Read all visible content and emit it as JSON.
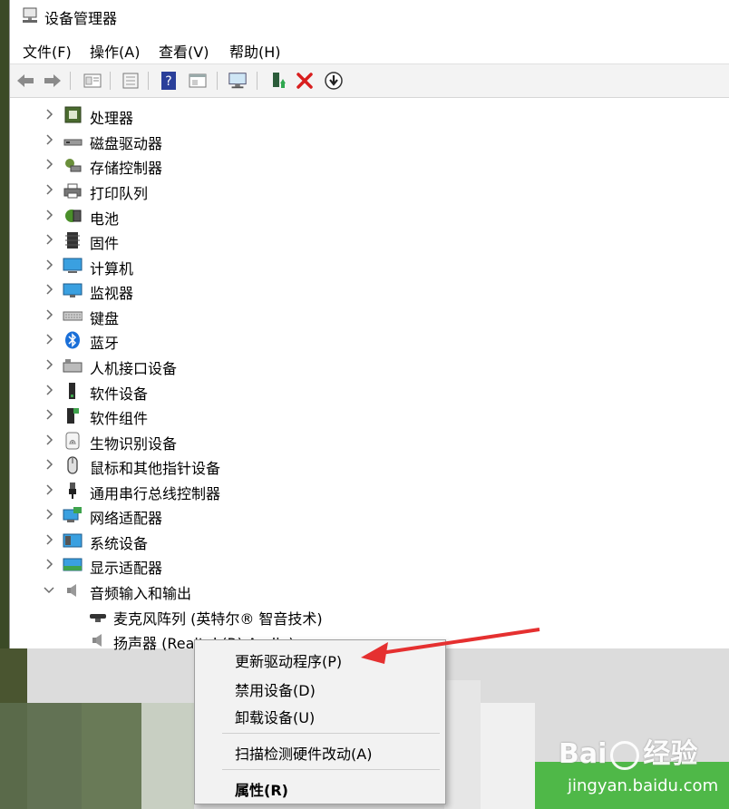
{
  "window": {
    "title": "设备管理器"
  },
  "menu": [
    "文件(F)",
    "操作(A)",
    "查看(V)",
    "帮助(H)"
  ],
  "toolbar": {
    "buttons": [
      "back-icon",
      "forward-icon",
      "properties-icon",
      "list-icon",
      "help-icon",
      "view-icon",
      "monitor-icon",
      "update-driver-icon",
      "uninstall-icon",
      "download-icon"
    ]
  },
  "tree": {
    "categories": [
      {
        "label": "处理器",
        "icon": "processor-icon"
      },
      {
        "label": "磁盘驱动器",
        "icon": "disk-icon"
      },
      {
        "label": "存储控制器",
        "icon": "storage-icon"
      },
      {
        "label": "打印队列",
        "icon": "printer-icon"
      },
      {
        "label": "电池",
        "icon": "battery-icon"
      },
      {
        "label": "固件",
        "icon": "firmware-icon"
      },
      {
        "label": "计算机",
        "icon": "computer-icon"
      },
      {
        "label": "监视器",
        "icon": "monitor-icon"
      },
      {
        "label": "键盘",
        "icon": "keyboard-icon"
      },
      {
        "label": "蓝牙",
        "icon": "bluetooth-icon"
      },
      {
        "label": "人机接口设备",
        "icon": "hid-icon"
      },
      {
        "label": "软件设备",
        "icon": "software-device-icon"
      },
      {
        "label": "软件组件",
        "icon": "software-component-icon"
      },
      {
        "label": "生物识别设备",
        "icon": "fingerprint-icon"
      },
      {
        "label": "鼠标和其他指针设备",
        "icon": "mouse-icon"
      },
      {
        "label": "通用串行总线控制器",
        "icon": "usb-icon"
      },
      {
        "label": "网络适配器",
        "icon": "network-icon"
      },
      {
        "label": "系统设备",
        "icon": "system-icon"
      },
      {
        "label": "显示适配器",
        "icon": "display-icon"
      },
      {
        "label": "音频输入和输出",
        "icon": "speaker-icon",
        "expanded": true
      }
    ],
    "children": [
      {
        "label": "麦克风阵列 (英特尔® 智音技术)",
        "icon": "microphone-icon"
      },
      {
        "label": "扬声器 (Realtek(R) Audio)",
        "icon": "speaker-icon"
      }
    ]
  },
  "context_menu": {
    "items": [
      {
        "label": "更新驱动程序(P)"
      },
      {
        "label": "禁用设备(D)"
      },
      {
        "label": "卸载设备(U)"
      },
      {
        "label": "扫描检测硬件改动(A)"
      },
      {
        "label": "属性(R)",
        "bold": true
      }
    ]
  },
  "watermark": {
    "brand": "Bai",
    "brand2": "经验",
    "url": "jingyan.baidu.com"
  },
  "colors": {
    "arrow": "#e53030",
    "watermark_bg": "#4fb848",
    "chevron": "#6a6a6a"
  }
}
